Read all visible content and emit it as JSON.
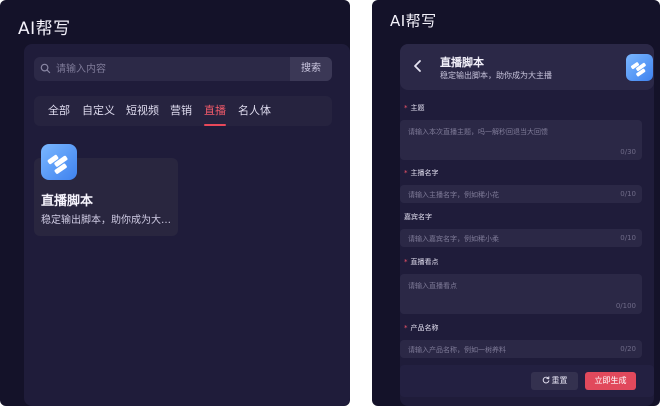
{
  "colors": {
    "panel_bg": "#141229",
    "card_bg": "#1f1c3a",
    "accent": "#e8485a",
    "generate_button": "#e1495c",
    "logo_gradient": [
      "#7ab7ff",
      "#3f82ef"
    ]
  },
  "left": {
    "title": "AI帮写",
    "search": {
      "placeholder": "请输入内容",
      "button_label": "搜索",
      "icon": "search-icon"
    },
    "tabs": [
      {
        "label": "全部",
        "active": false
      },
      {
        "label": "自定义",
        "active": false
      },
      {
        "label": "短视频",
        "active": false
      },
      {
        "label": "营销",
        "active": false
      },
      {
        "label": "直播",
        "active": true
      },
      {
        "label": "名人体",
        "active": false
      }
    ],
    "tool": {
      "title": "直播脚本",
      "desc": "稳定输出脚本，助你成为大…",
      "icon": "app-logo-icon"
    }
  },
  "right": {
    "title": "AI帮写",
    "header": {
      "title": "直播脚本",
      "desc": "稳定输出脚本，助你成为大主播",
      "back_icon": "chevron-left-icon",
      "logo_icon": "app-logo-icon"
    },
    "fields": {
      "topic": {
        "label": "主题",
        "required": true,
        "placeholder": "请输入本次直播主题，吗一解秒回退当大回馈",
        "count": "0/30"
      },
      "host": {
        "label": "主播名字",
        "required": true,
        "placeholder": "请输入主播名字，例如稀小花",
        "count": "0/10"
      },
      "guest": {
        "label": "嘉宾名字",
        "required": false,
        "placeholder": "请输入嘉宾名字，例如稀小柔",
        "count": "0/10"
      },
      "highlights": {
        "label": "直播看点",
        "required": true,
        "placeholder": "请输入直播看点",
        "count": "0/100"
      },
      "product": {
        "label": "产品名称",
        "required": true,
        "placeholder": "请输入产品名称，例如一树养料",
        "count": "0/20"
      }
    },
    "buttons": {
      "reset": "重置",
      "generate": "立即生成",
      "reset_icon": "refresh-icon"
    }
  }
}
